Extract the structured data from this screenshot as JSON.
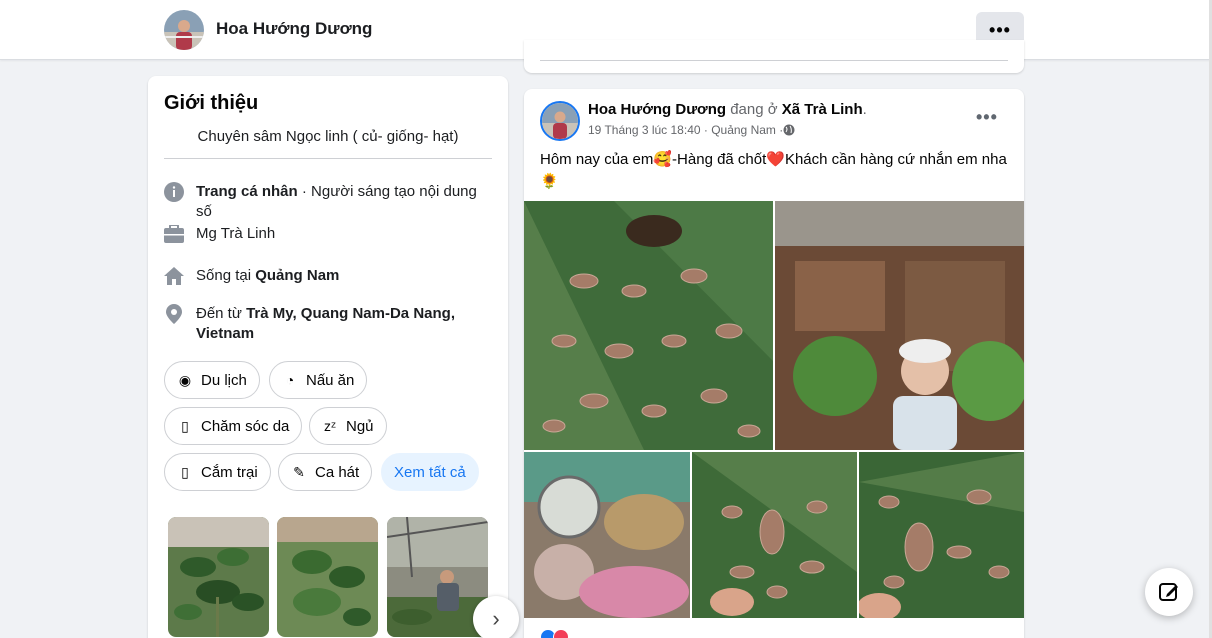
{
  "header": {
    "profile_name": "Hoa Hướng Dương",
    "more_label": "•••"
  },
  "intro": {
    "title": "Giới thiệu",
    "bio": "Chuyên sâm Ngọc linh ( củ- giống- hạt)",
    "details": {
      "page_type_bold": "Trang cá nhân",
      "page_type_rest": " · Người sáng tạo nội dung số",
      "work": "Mg Trà Linh",
      "lives_prefix": "Sống tại ",
      "lives_place": "Quảng Nam",
      "from_prefix": "Đến từ ",
      "from_place": "Trà My, Quang Nam-Da Nang, Vietnam"
    },
    "hobbies": [
      {
        "label": "Du lịch",
        "icon": "globe-icon",
        "glyph": "◉"
      },
      {
        "label": "Nấu ăn",
        "icon": "cooking-icon",
        "glyph": "◔"
      },
      {
        "label": "Chăm sóc da",
        "icon": "skincare-icon",
        "glyph": "▯"
      },
      {
        "label": "Ngủ",
        "icon": "sleep-icon",
        "glyph": "zᶻ"
      },
      {
        "label": "Cắm trại",
        "icon": "camping-icon",
        "glyph": "▯"
      },
      {
        "label": "Ca hát",
        "icon": "microphone-icon",
        "glyph": "✎"
      }
    ],
    "see_all": "Xem tất cả",
    "next_glyph": "›"
  },
  "post": {
    "author": "Hoa Hướng Dương",
    "at_text": " đang ở ",
    "place": "Xã Trà Linh",
    "place_suffix": ".",
    "meta": "19 Tháng 3 lúc 18:40 · Quảng Nam · ",
    "more_label": "•••",
    "text": "Hôm nay của em🥰-Hàng đã chốt❤️Khách cần hàng cứ nhắn em nha 🌻"
  },
  "colors": {
    "accent": "#1877f2",
    "chip_see_all_bg": "#e7f3ff",
    "secondary_text": "#65676b"
  }
}
